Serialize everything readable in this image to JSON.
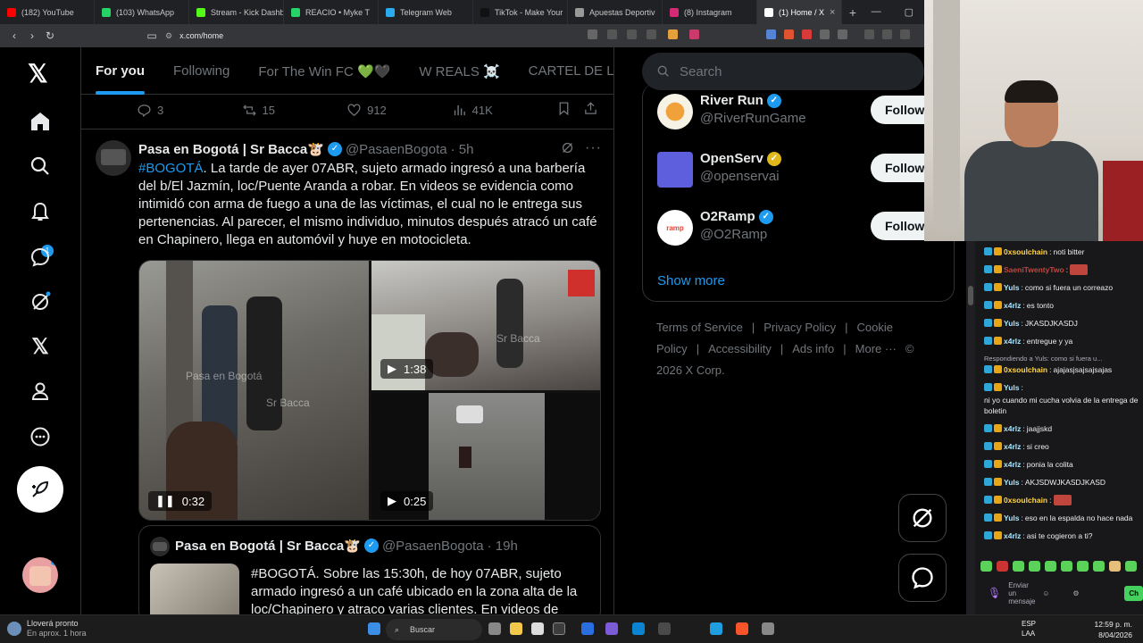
{
  "browser": {
    "tabs": [
      {
        "label": "(182) YouTube",
        "color": "#ff0000"
      },
      {
        "label": "(103) WhatsApp",
        "color": "#25d366"
      },
      {
        "label": "Stream - Kick Dashb",
        "color": "#53fc18"
      },
      {
        "label": "REACIO • Myke T",
        "color": "#25d366"
      },
      {
        "label": "Telegram Web",
        "color": "#2aabee"
      },
      {
        "label": "TikTok - Make Your",
        "color": "#111111"
      },
      {
        "label": "Apuestas Deportiv",
        "color": "#999999"
      },
      {
        "label": "(8) Instagram",
        "color": "#d62976"
      },
      {
        "label": "(1) Home / X",
        "color": "#ffffff",
        "active": true
      }
    ],
    "url": "x.com/home",
    "close_icon": "×",
    "newtab": "+"
  },
  "nav": {
    "notifications_badge": "1"
  },
  "feed": {
    "tabs": [
      "For you",
      "Following",
      "For The Win FC 💚🖤",
      "W REALS ☠️",
      "CARTEL DE LC"
    ],
    "prev_actions": {
      "replies": "3",
      "reposts": "15",
      "likes": "912",
      "views": "41K"
    },
    "tweet1": {
      "name": "Pasa en Bogotá | Sr Bacca🐮",
      "handle": "@PasaenBogota",
      "time": "· 5h",
      "hashtag": "#BOGOTÁ",
      "text": ". La tarde de ayer 07ABR, sujeto armado ingresó a una barbería del b/El Jazmín, loc/Puente Aranda a robar. En videos se evidencia como intimidó con arma de fuego a una de las víctimas, el cual no le entrega sus pertenencias. Al parecer, el mismo individuo, minutos después atracó un café en Chapinero, llega en automóvil y huye en motocicleta.",
      "videos": [
        {
          "duration": "0:32",
          "state": "pause"
        },
        {
          "duration": "1:38",
          "state": "play"
        },
        {
          "duration": "0:25",
          "state": "play"
        }
      ],
      "watermark1": "Pasa en Bogotá",
      "watermark2": "Sr Bacca",
      "watermark3": "Sr Bacca"
    },
    "tweet2": {
      "name": "Pasa en Bogotá | Sr Bacca🐮",
      "handle": "@PasaenBogota",
      "time": "· 19h",
      "text": "#BOGOTÁ. Sobre las 15:30h, de hoy 07ABR, sujeto armado ingresó a un café ubicado en la zona alta de la loc/Chapinero y atraco varias clientes. En videos de"
    }
  },
  "sidebar": {
    "search_placeholder": "Search",
    "follow": [
      {
        "name": "River Run",
        "handle": "@RiverRunGame",
        "verified": "blue",
        "button": "Follow"
      },
      {
        "name": "OpenServ",
        "handle": "@openservai",
        "verified": "gold",
        "button": "Follow"
      },
      {
        "name": "O2Ramp",
        "handle": "@O2Ramp",
        "verified": "blue",
        "button": "Follow"
      }
    ],
    "show_more": "Show more",
    "footer": [
      "Terms of Service",
      "|",
      "Privacy Policy",
      "|",
      "Cookie Policy",
      "|",
      "Accessibility",
      "|",
      "Ads info",
      "|",
      "More ···",
      "© 2026 X Corp."
    ],
    "o2ramp_logo_text": "ramp"
  },
  "chat": {
    "messages": [
      {
        "user": "0xsoulchain",
        "text": "noti bitter",
        "color": "#ffd54a"
      },
      {
        "user": "SaeniTwentyTwo",
        "text": "",
        "color": "#c0463d",
        "emote": true
      },
      {
        "user": "Yuls",
        "text": "como si fuera un correazo",
        "color": "#a8e6ff"
      },
      {
        "user": "x4rlz",
        "text": "es tonto",
        "color": "#a8e6ff"
      },
      {
        "user": "Yuls",
        "text": "JKASDJKASDJ",
        "color": "#a8e6ff"
      },
      {
        "user": "x4rlz",
        "text": "entregue y ya",
        "color": "#a8e6ff"
      },
      {
        "reply": "Respondiendo a Yuls: como si fuera u..."
      },
      {
        "user": "0xsoulchain",
        "text": "ajajasjsajsajsajas",
        "color": "#ffd54a"
      },
      {
        "user": "Yuls",
        "text": "ni yo cuando mi cucha volvia de la entrega de boletin",
        "color": "#a8e6ff"
      },
      {
        "user": "x4rlz",
        "text": "jaajjskd",
        "color": "#a8e6ff"
      },
      {
        "user": "x4rlz",
        "text": "si creo",
        "color": "#a8e6ff"
      },
      {
        "user": "x4rlz",
        "text": "ponia la colita",
        "color": "#a8e6ff"
      },
      {
        "user": "Yuls",
        "text": "AKJSDWJKASDJKASD",
        "color": "#a8e6ff"
      },
      {
        "user": "0xsoulchain",
        "text": "",
        "color": "#ffd54a",
        "emote": true
      },
      {
        "user": "Yuls",
        "text": "eso en la espalda no hace nada",
        "color": "#a8e6ff"
      },
      {
        "user": "x4rlz",
        "text": "asi te cogieron a ti?",
        "color": "#a8e6ff"
      }
    ],
    "input_placeholder": "Enviar un mensaje",
    "send": "Ch"
  },
  "taskbar": {
    "weather": "Lloverá pronto",
    "weather_sub": "En aprox. 1 hora",
    "search": "Buscar",
    "lang1": "ESP",
    "lang2": "LAA",
    "time": "12:59 p. m.",
    "date": "8/04/2026"
  }
}
